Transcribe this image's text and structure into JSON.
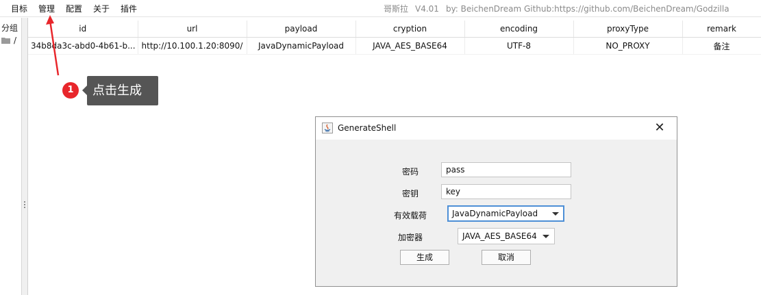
{
  "menubar": {
    "items": [
      "目标",
      "管理",
      "配置",
      "关于",
      "插件"
    ],
    "app_title": {
      "name": "哥斯拉",
      "version": "V4.01",
      "credit": "by: BeichenDream Github:https://github.com/BeichenDream/Godzilla"
    }
  },
  "group_panel": {
    "header": "分组",
    "root": "/"
  },
  "table": {
    "columns": [
      "id",
      "url",
      "payload",
      "cryption",
      "encoding",
      "proxyType",
      "remark"
    ],
    "rows": [
      [
        "34b8da3c-abd0-4b61-b...",
        "http://10.100.1.20:8090/",
        "JavaDynamicPayload",
        "JAVA_AES_BASE64",
        "UTF-8",
        "NO_PROXY",
        "备注"
      ]
    ]
  },
  "callout": {
    "step": "1",
    "text": "点击生成",
    "color": "#e8262b"
  },
  "dialog": {
    "title": "GenerateShell",
    "close_symbol": "✕",
    "fields": {
      "password_label": "密码",
      "password_value": "pass",
      "key_label": "密钥",
      "key_value": "key",
      "payload_label": "有效载荷",
      "payload_value": "JavaDynamicPayload",
      "cryption_label": "加密器",
      "cryption_value": "JAVA_AES_BASE64"
    },
    "buttons": {
      "generate": "生成",
      "cancel": "取消"
    },
    "focus_color": "#4d8fd6"
  }
}
